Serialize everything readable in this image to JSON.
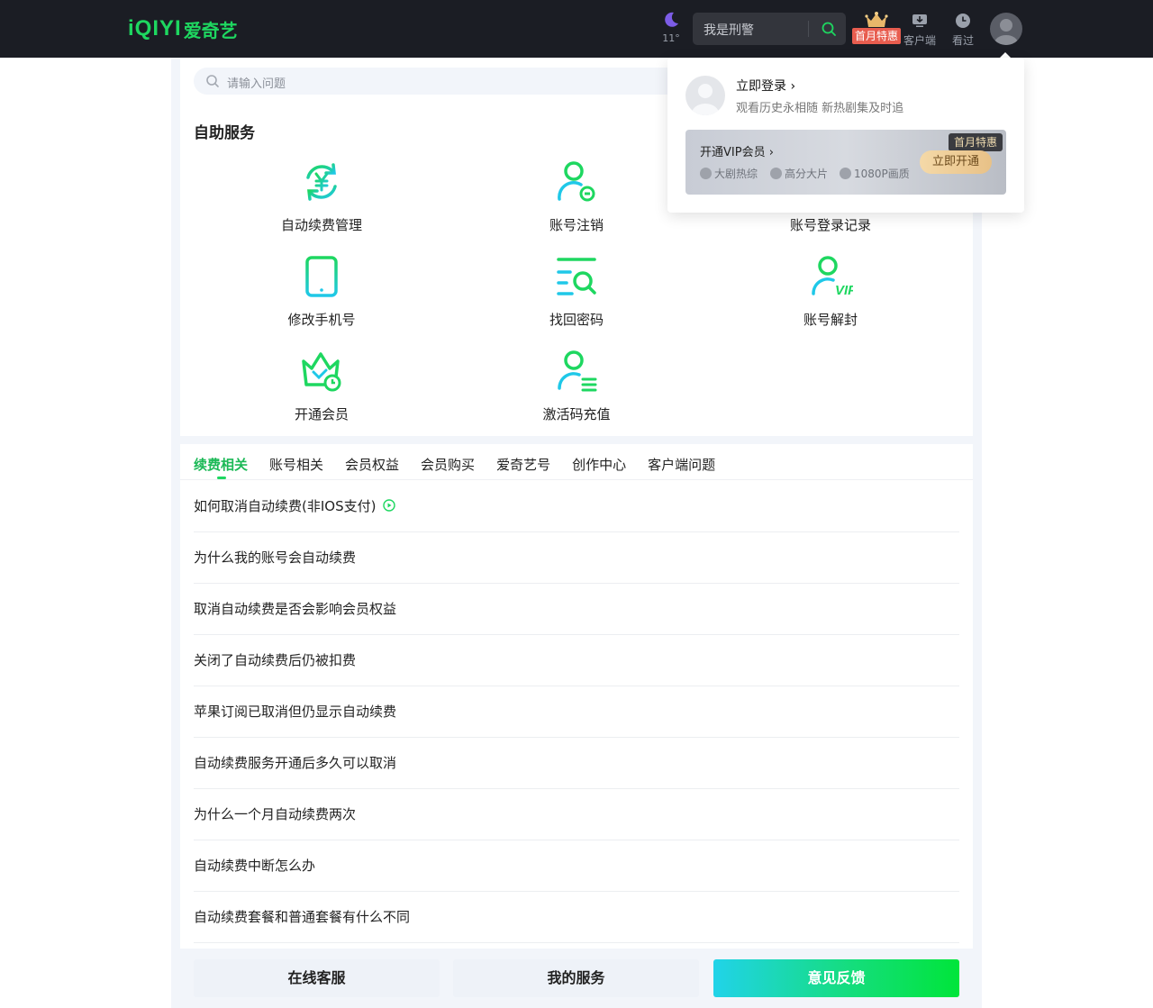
{
  "header": {
    "logo_text": "iQIYI",
    "logo_cn": "爱奇艺",
    "weather_temp": "11°",
    "search_value": "我是刑警",
    "vip_tag": "首月特惠",
    "client_label": "客户端",
    "history_label": "看过"
  },
  "help": {
    "search_placeholder": "请输入问题",
    "section_title": "自助服务",
    "services": [
      {
        "label": "自动续费管理"
      },
      {
        "label": "账号注销"
      },
      {
        "label": "账号登录记录"
      },
      {
        "label": "修改手机号"
      },
      {
        "label": "找回密码"
      },
      {
        "label": "账号解封"
      },
      {
        "label": "开通会员"
      },
      {
        "label": "激活码充值"
      }
    ]
  },
  "tabs": [
    "续费相关",
    "账号相关",
    "会员权益",
    "会员购买",
    "爱奇艺号",
    "创作中心",
    "客户端问题"
  ],
  "faq": [
    "如何取消自动续费(非IOS支付)",
    "为什么我的账号会自动续费",
    "取消自动续费是否会影响会员权益",
    "关闭了自动续费后仍被扣费",
    "苹果订阅已取消但仍显示自动续费",
    "自动续费服务开通后多久可以取消",
    "为什么一个月自动续费两次",
    "自动续费中断怎么办",
    "自动续费套餐和普通套餐有什么不同"
  ],
  "bottom": {
    "online_service": "在线客服",
    "my_service": "我的服务",
    "feedback": "意见反馈"
  },
  "popover": {
    "login": "立即登录",
    "subtitle": "观看历史永相随 新热剧集及时追",
    "vip_title": "开通VIP会员",
    "features": [
      "大剧热综",
      "高分大片",
      "1080P画质"
    ],
    "tag": "首月特惠",
    "open_button": "立即开通"
  },
  "colors": {
    "brand_green": "#1ed760",
    "header_bg": "#1b1d24",
    "page_bg": "#f2f5fa"
  }
}
